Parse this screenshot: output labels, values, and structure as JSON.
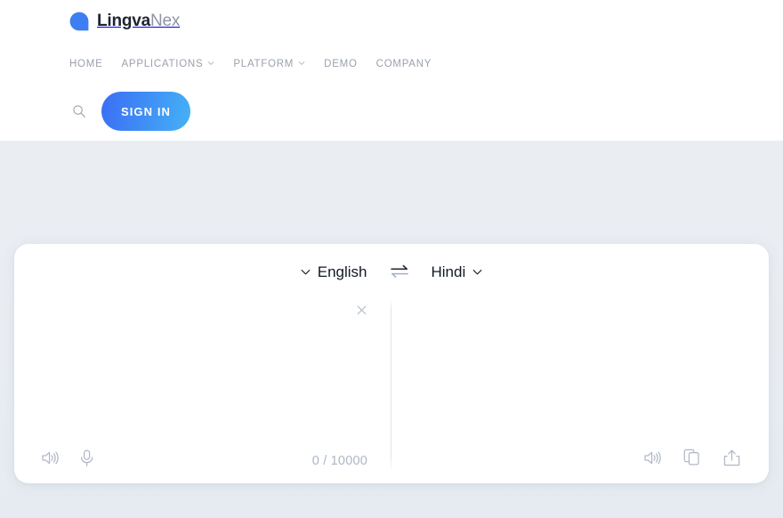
{
  "header": {
    "logo": {
      "mark_icon": "speech-bubble-logo-icon",
      "text_primary": "Lingva",
      "text_secondary": "Nex",
      "mark_color": "#3d7ef2"
    },
    "nav": [
      {
        "label": "HOME",
        "has_dropdown": false
      },
      {
        "label": "APPLICATIONS",
        "has_dropdown": true
      },
      {
        "label": "PLATFORM",
        "has_dropdown": true
      },
      {
        "label": "DEMO",
        "has_dropdown": false
      },
      {
        "label": "COMPANY",
        "has_dropdown": false
      }
    ],
    "search_icon": "search-icon",
    "sign_in_label": "SIGN IN",
    "sign_in_gradient_from": "#3b6ef6",
    "sign_in_gradient_to": "#45b2f6"
  },
  "translator": {
    "source_language": "English",
    "target_language": "Hindi",
    "swap_icon": "swap-arrows-icon",
    "source": {
      "value": "",
      "placeholder": "",
      "clear_icon": "close-icon",
      "speaker_icon": "volume-icon",
      "microphone_icon": "microphone-icon",
      "char_count": "0 / 10000"
    },
    "target": {
      "value": "",
      "speaker_icon": "volume-icon",
      "copy_icon": "copy-icon",
      "share_icon": "share-icon"
    }
  },
  "colors": {
    "page_background": "#eaeef3",
    "card_background": "#ffffff",
    "header_background": "#ffffff",
    "nav_text": "#9aa1ad",
    "muted_icon": "#b0b8c6",
    "primary_text": "#121826"
  }
}
